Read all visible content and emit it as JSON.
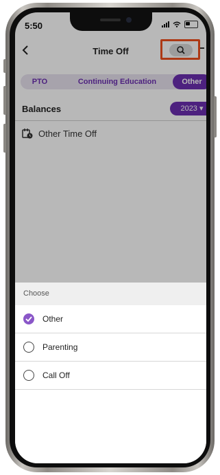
{
  "status_bar": {
    "time": "5:50"
  },
  "nav": {
    "title": "Time Off",
    "back_icon": "chevron-left-icon",
    "search_icon": "search-icon"
  },
  "tabs": [
    {
      "label": "PTO",
      "selected": false
    },
    {
      "label": "Continuing Education",
      "selected": false
    },
    {
      "label": "Other",
      "selected": true
    }
  ],
  "balances": {
    "label": "Balances",
    "year": "2023"
  },
  "list": {
    "items": [
      {
        "label": "Other Time Off",
        "icon": "calendar-clock-icon"
      }
    ]
  },
  "sheet": {
    "title": "Choose",
    "options": [
      {
        "label": "Other",
        "selected": true
      },
      {
        "label": "Parenting",
        "selected": false
      },
      {
        "label": "Call Off",
        "selected": false
      }
    ]
  },
  "colors": {
    "accent": "#6b2fb0",
    "check": "#8a57c8",
    "highlight": "#f0501e"
  }
}
